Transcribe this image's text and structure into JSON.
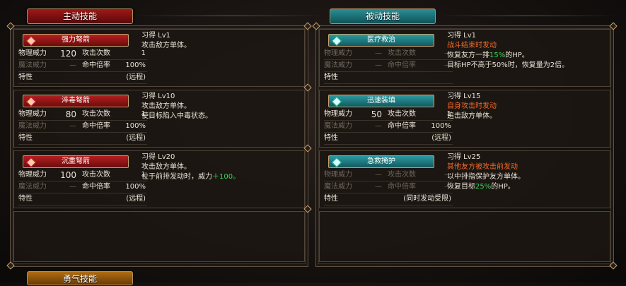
{
  "tabs": {
    "active": "主动技能",
    "passive": "被动技能",
    "courage": "勇气技能"
  },
  "labels": {
    "phys": "物理威力",
    "hits": "攻击次数",
    "magic": "魔法威力",
    "hitrate": "命中倍率",
    "trait": "特性",
    "dash": "—"
  },
  "active_skills": [
    {
      "name": "强力弩箭",
      "phys": "120",
      "hits": "1",
      "hitrate": "100%",
      "trait": "(远程)",
      "learn": "习得 Lv1",
      "desc1": "攻击敌方单体。",
      "desc2": "",
      "desc2_b": ""
    },
    {
      "name": "淬毒弩箭",
      "phys": "80",
      "hits": "1",
      "hitrate": "100%",
      "trait": "(远程)",
      "learn": "习得 Lv10",
      "desc1": "攻击敌方单体。",
      "desc2": "使目标陷入中毒状态。",
      "desc2_b": ""
    },
    {
      "name": "沉重弩箭",
      "phys": "100",
      "hits": "1",
      "hitrate": "100%",
      "trait": "(远程)",
      "learn": "习得 Lv20",
      "desc1": "攻击敌方单体。",
      "desc2": "位于前排发动时，威力",
      "desc2_b": "＋100。"
    }
  ],
  "passive_skills": [
    {
      "name": "医疗救治",
      "phys": "—",
      "hits": "—",
      "hitrate": "—",
      "trait": "",
      "learn": "习得 Lv1",
      "trigger": "战斗结束时发动",
      "line1a": "恢复友方一排",
      "line1b": "15%",
      "line1c": "的HP。",
      "line2": "目标HP不高于50%时，恢复量为2倍。"
    },
    {
      "name": "迅速装填",
      "phys": "50",
      "hits": "1",
      "hitrate": "100%",
      "trait": "(远程)",
      "learn": "习得 Lv15",
      "trigger": "自身攻击时发动",
      "line1a": "追击敌方单体。",
      "line1b": "",
      "line1c": "",
      "line2": ""
    },
    {
      "name": "急救掩护",
      "phys": "—",
      "hits": "—",
      "hitrate": "—",
      "trait": "(同时发动受限)",
      "learn": "习得 Lv25",
      "trigger": "其他友方被攻击前发动",
      "line1a": "以中排指保护友方单体。",
      "line1b": "",
      "line1c": "",
      "line2a": "恢复目标",
      "line2b": "25%",
      "line2c": "的HP。"
    }
  ],
  "colors": {
    "active": "#a01818",
    "passive": "#2b8f95",
    "trigger": "#f26a2a",
    "highlight": "#3fd35a"
  }
}
